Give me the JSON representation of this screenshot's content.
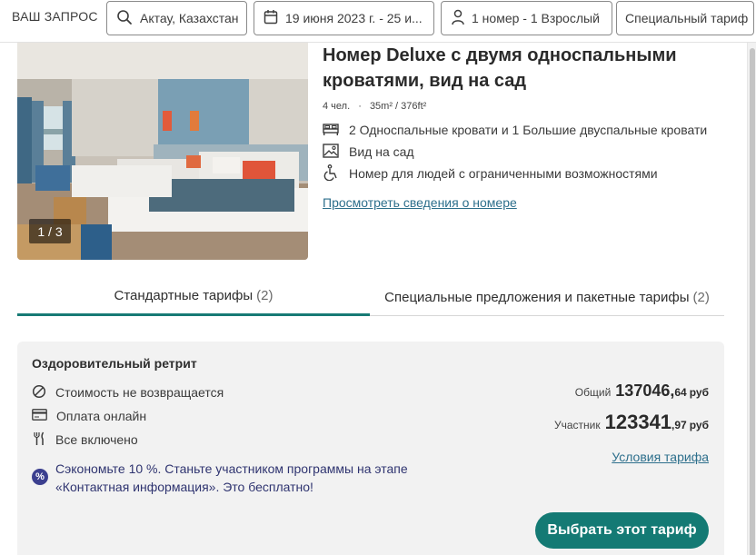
{
  "search_bar": {
    "query_label": "ВАШ ЗАПРОС",
    "location": "Актау, Казахстан",
    "dates": "19 июня 2023 г. - 25 и...",
    "guests": "1 номер - 1 Взрослый",
    "rate_type": "Специальный тариф",
    "icons": [
      "search-icon",
      "calendar-icon",
      "person-icon"
    ]
  },
  "room": {
    "photo_counter": "1 / 3",
    "title": "Номер Deluxe с двумя односпальными кроватями, вид на сад",
    "occupancy": "4 чел.",
    "separator": "·",
    "size": "35m² / 376ft²",
    "features": [
      {
        "icon": "bed-icon",
        "label": "2 Односпальные кровати и 1 Большие двуспальные кровати"
      },
      {
        "icon": "view-icon",
        "label": "Вид на сад"
      },
      {
        "icon": "accessibility-icon",
        "label": "Номер для людей с ограниченными возможностями"
      }
    ],
    "details_link": "Просмотреть сведения о номере"
  },
  "tabs": [
    {
      "label": "Стандартные тарифы",
      "count": "(2)",
      "active": true
    },
    {
      "label": "Специальные предложения и пакетные тарифы",
      "count": "(2)",
      "active": false
    }
  ],
  "rate": {
    "name": "Оздоровительный ретрит",
    "features": [
      {
        "icon": "no-refund-icon",
        "label": "Стоимость не возвращается"
      },
      {
        "icon": "credit-card-icon",
        "label": "Оплата онлайн"
      },
      {
        "icon": "cutlery-icon",
        "label": "Все включено"
      }
    ],
    "promo_badge": "%",
    "promo_text": "Сэкономьте 10 %. Станьте участником программы на этапе «Контактная информация». Это бесплатно!",
    "total_label": "Общий",
    "total_main": "137046,",
    "total_cents": "64",
    "member_label": "Участник",
    "member_main": "123341",
    "member_cents": ",97",
    "currency": "руб",
    "terms_link": "Условия тарифа",
    "select_button": "Выбрать этот тариф"
  },
  "colors": {
    "accent_teal": "#147a74",
    "link_blue": "#2d6f8c",
    "promo_navy": "#3b3f8f",
    "card_bg": "#f2f2f2"
  }
}
